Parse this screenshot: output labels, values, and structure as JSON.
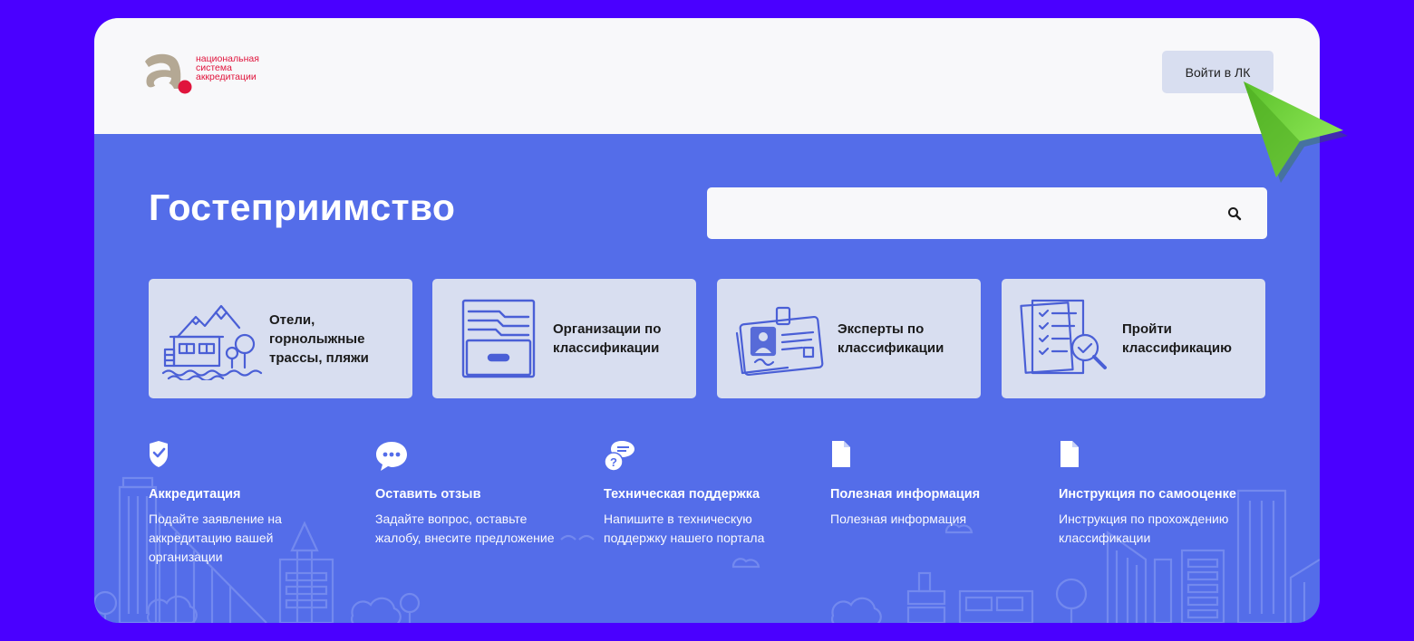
{
  "logo": {
    "line1": "национальная",
    "line2": "система",
    "line3": "аккредитации"
  },
  "header": {
    "login_label": "Войти в ЛК"
  },
  "hero": {
    "title": "Гостеприимство",
    "search_placeholder": "",
    "search_icon": "search-icon"
  },
  "cards": [
    {
      "label": "Отели, горнолыжные трассы, пляжи",
      "icon": "hotel-mountain-icon"
    },
    {
      "label": "Организации по классификации",
      "icon": "filing-cabinet-icon"
    },
    {
      "label": "Эксперты по классификации",
      "icon": "id-badge-icon"
    },
    {
      "label": "Пройти классификацию",
      "icon": "checklist-magnifier-icon"
    }
  ],
  "links": [
    {
      "title": "Аккредитация",
      "desc": "Подайте заявление на аккредитацию вашей организации",
      "icon": "shield-check-icon"
    },
    {
      "title": "Оставить отзыв",
      "desc": "Задайте вопрос, оставьте жалобу, внесите предложение",
      "icon": "chat-bubble-icon"
    },
    {
      "title": "Техническая поддержка",
      "desc": "Напишите в техническую поддержку нашего портала",
      "icon": "support-chat-icon"
    },
    {
      "title": "Полезная информация",
      "desc": "Полезная информация",
      "icon": "document-icon"
    },
    {
      "title": "Инструкция по самооценке",
      "desc": "Инструкция по прохождению классификации",
      "icon": "document-icon"
    }
  ],
  "colors": {
    "outer_background": "#4a00ff",
    "hero_background": "#546de9",
    "header_background": "#f8f8fa",
    "card_background": "#d8def0",
    "logo_red": "#e0143c",
    "cursor_green": "#7ee04a"
  }
}
